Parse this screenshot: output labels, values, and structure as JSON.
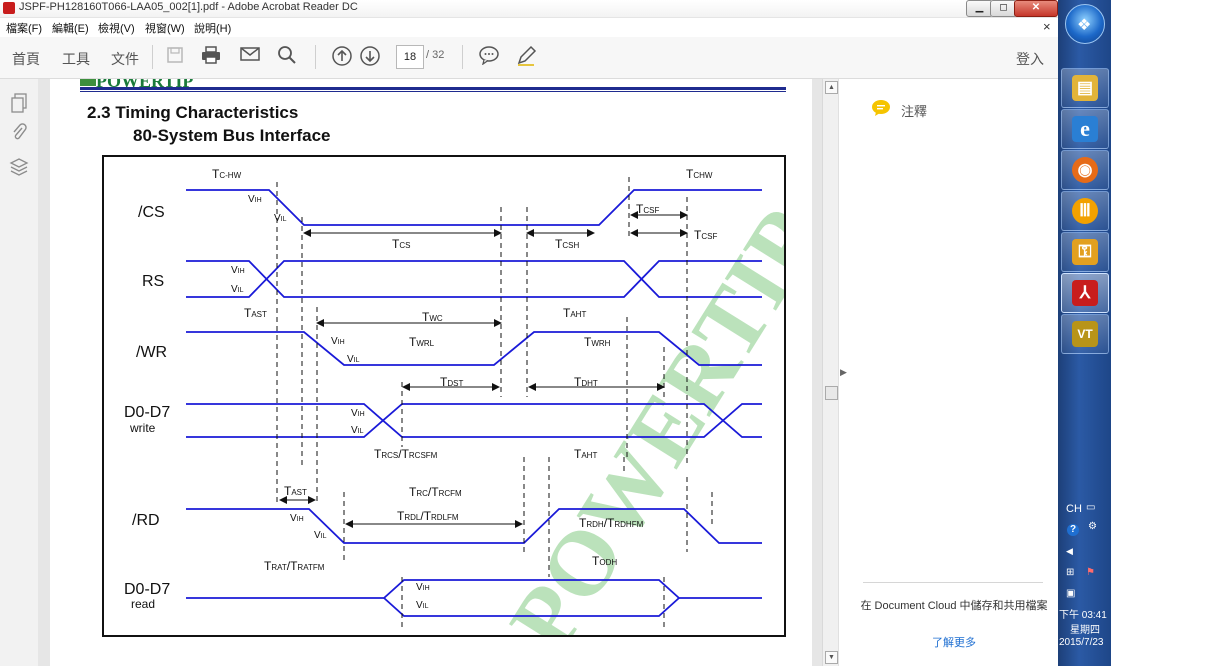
{
  "window": {
    "title": "JSPF-PH128160T066-LAA05_002[1].pdf - Adobe Acrobat Reader DC",
    "minimize_glyph": "▁",
    "maximize_glyph": "◻",
    "close_glyph": "✕",
    "doc_close_glyph": "×"
  },
  "menu": {
    "items": [
      "檔案(F)",
      "編輯(E)",
      "檢視(V)",
      "視窗(W)",
      "說明(H)"
    ]
  },
  "toolbar": {
    "home": "首頁",
    "tools": "工具",
    "document": "文件",
    "page_current": "18",
    "page_total": "/ 32",
    "login": "登入",
    "icons": [
      "save-icon",
      "print-icon",
      "email-icon",
      "search-icon",
      "arrow-up-circle-icon",
      "arrow-down-circle-icon",
      "comment-icon",
      "pen-icon"
    ]
  },
  "leftnav": {
    "icons": [
      "pages-icon",
      "attachment-icon",
      "layers-icon"
    ],
    "collapse_glyph": "◀"
  },
  "document": {
    "logo_text": "POWERTIP",
    "heading": "2.3 Timing Characteristics",
    "subheading": "80-System Bus Interface",
    "diagram": {
      "signals": [
        {
          "name": "/CS",
          "sub": ""
        },
        {
          "name": "RS",
          "sub": ""
        },
        {
          "name": "/WR",
          "sub": ""
        },
        {
          "name": "D0-D7",
          "sub": "write"
        },
        {
          "name": "/RD",
          "sub": ""
        },
        {
          "name": "D0-D7",
          "sub": "read"
        }
      ],
      "labels": {
        "tchw_left": "T",
        "tchw_left_sub": "C-HW",
        "tchw_right": "T",
        "tchw_right_sub": "CHW",
        "tcs": "T",
        "tcs_sub": "CS",
        "tcsh": "T",
        "tcsh_sub": "CSH",
        "tcsf1": "T",
        "tcsf1_sub": "CSF",
        "tcsf2": "T",
        "tcsf2_sub": "CSF",
        "tast1": "T",
        "tast1_sub": "AST",
        "twc": "T",
        "twc_sub": "WC",
        "taht1": "T",
        "taht1_sub": "AHT",
        "twrl": "T",
        "twrl_sub": "WRL",
        "twrh": "T",
        "twrh_sub": "WRH",
        "tdst": "T",
        "tdst_sub": "DST",
        "tdht": "T",
        "tdht_sub": "DHT",
        "trcs": "T",
        "trcs_sub": "RCS",
        "trcs2": "/T",
        "trcs2_sub": "RCSFM",
        "taht2": "T",
        "taht2_sub": "AHT",
        "tast2": "T",
        "tast2_sub": "AST",
        "trc": "T",
        "trc_sub": "RC",
        "trc2": "/T",
        "trc2_sub": "RCFM",
        "trdl": "T",
        "trdl_sub": "RDL",
        "trdl2": "/T",
        "trdl2_sub": "RDLFM",
        "trdh": "T",
        "trdh_sub": "RDH",
        "trdh2": "/T",
        "trdh2_sub": "RDHFM",
        "trat": "T",
        "trat_sub": "RAT",
        "trat2": "/T",
        "trat2_sub": "RATFM",
        "todh": "T",
        "todh_sub": "ODH",
        "vih": "V",
        "vih_sub": "IH",
        "vil": "V",
        "vil_sub": "IL"
      },
      "watermark_text": "POWERTIP"
    }
  },
  "rightpane": {
    "comment_label": "注釋",
    "promo": "在 Document Cloud 中儲存和共用檔案",
    "learn_more": "了解更多",
    "expand_glyph": "▶"
  },
  "taskbar": {
    "apps": [
      {
        "name": "file-explorer",
        "glyph": "▤",
        "color": "#e2b43a"
      },
      {
        "name": "internet-explorer",
        "glyph": "e",
        "color": "#2a7fd4"
      },
      {
        "name": "firefox",
        "glyph": "◉",
        "color": "#e66b18"
      },
      {
        "name": "app-orange",
        "glyph": "Ⅲ",
        "color": "#f2a100"
      },
      {
        "name": "app-yellow",
        "glyph": "⚿",
        "color": "#e2a020"
      },
      {
        "name": "acrobat-reader",
        "glyph": "⅄",
        "color": "#c81d1d"
      },
      {
        "name": "app-vt",
        "glyph": "VT",
        "color": "#b89418"
      }
    ],
    "lang": "CH",
    "time": "下午 03:41",
    "weekday": "星期四",
    "date": "2015/7/23"
  },
  "colors": {
    "signal": "#1a1ad8",
    "watermark": "#3fae3f",
    "accent_blue": "#1f6fd1"
  }
}
